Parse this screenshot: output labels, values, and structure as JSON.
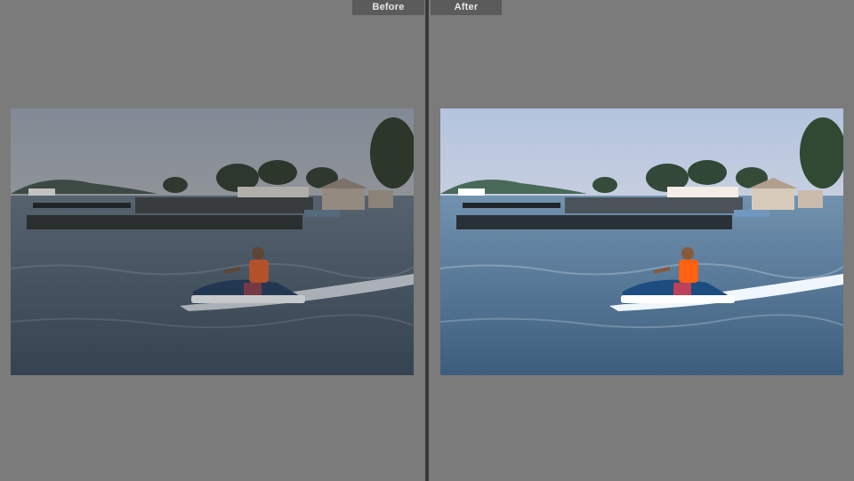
{
  "compare_view": {
    "before_label": "Before",
    "after_label": "After"
  },
  "colors": {
    "background": "#7b7b7b",
    "label_background": "#5b5b5b",
    "label_text": "#e6e6e6",
    "divider": "#3a3a3a"
  },
  "photos": {
    "before": {
      "tone": "muted-dark",
      "sky_top": "#8c98a8",
      "sky_bottom": "#c3b9b2",
      "water": "#3f5264"
    },
    "after": {
      "tone": "bright-cool",
      "sky_top": "#a8b6cc",
      "sky_bottom": "#dcd4d4",
      "water": "#4e6a82"
    }
  }
}
